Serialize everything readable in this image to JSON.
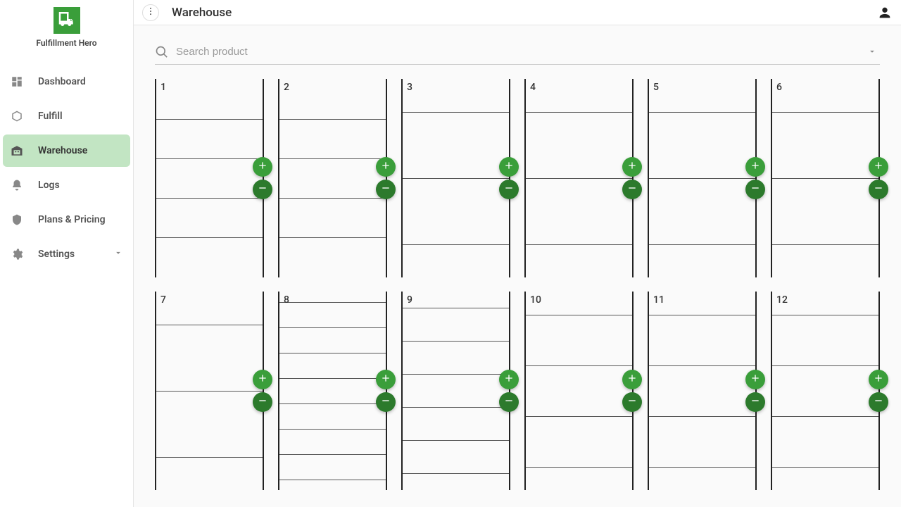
{
  "brand_name": "Fulfillment Hero",
  "page_title": "Warehouse",
  "search": {
    "placeholder": "Search product"
  },
  "sidebar": {
    "items": [
      {
        "id": "dashboard",
        "label": "Dashboard",
        "active": false
      },
      {
        "id": "fulfill",
        "label": "Fulfill",
        "active": false
      },
      {
        "id": "warehouse",
        "label": "Warehouse",
        "active": true
      },
      {
        "id": "logs",
        "label": "Logs",
        "active": false
      },
      {
        "id": "plans",
        "label": "Plans & Pricing",
        "active": false
      },
      {
        "id": "settings",
        "label": "Settings",
        "active": false,
        "has_chevron": true
      }
    ]
  },
  "colors": {
    "brand_green": "#3a9e3a",
    "dark_green": "#2c7a2c",
    "active_bg": "#c2e5c3"
  },
  "slots": [
    {
      "number": "1",
      "shelves": 3,
      "height_class": "a"
    },
    {
      "number": "2",
      "shelves": 3,
      "height_class": "a"
    },
    {
      "number": "3",
      "shelves": 2,
      "height_class": "b"
    },
    {
      "number": "4",
      "shelves": 2,
      "height_class": "b"
    },
    {
      "number": "5",
      "shelves": 2,
      "height_class": "b"
    },
    {
      "number": "6",
      "shelves": 2,
      "height_class": "b"
    },
    {
      "number": "7",
      "shelves": 2,
      "height_class": "b"
    },
    {
      "number": "8",
      "shelves": 7,
      "height_class": "c"
    },
    {
      "number": "9",
      "shelves": 5,
      "height_class": "d"
    },
    {
      "number": "10",
      "shelves": 3,
      "height_class": "e"
    },
    {
      "number": "11",
      "shelves": 3,
      "height_class": "e"
    },
    {
      "number": "12",
      "shelves": 3,
      "height_class": "e"
    }
  ],
  "shelf_heights": {
    "a": 56,
    "b": 94,
    "c": 36,
    "d": 47,
    "e": 72
  }
}
